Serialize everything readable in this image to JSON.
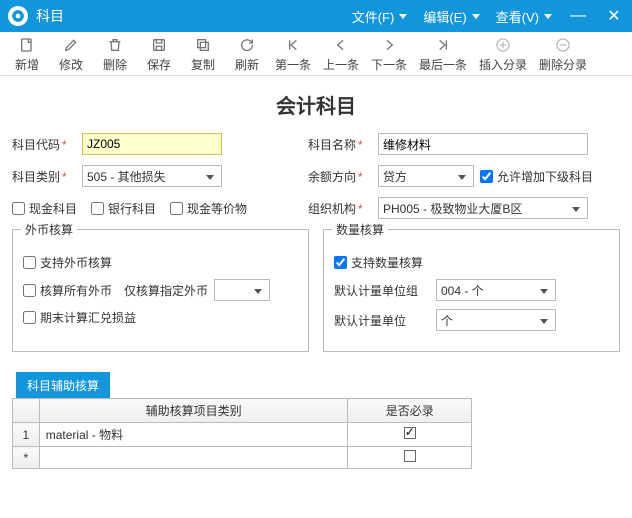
{
  "window": {
    "title": "科目",
    "menus": {
      "file": "文件(F)",
      "edit": "编辑(E)",
      "view": "查看(V)"
    }
  },
  "toolbar": {
    "new": "新增",
    "edit": "修改",
    "delete": "删除",
    "save": "保存",
    "copy": "复制",
    "refresh": "刷新",
    "first": "第一条",
    "prev": "上一条",
    "next": "下一条",
    "last": "最后一条",
    "insert_entry": "插入分录",
    "delete_entry": "删除分录"
  },
  "page_title": "会计科目",
  "fields": {
    "code_label": "科目代码",
    "code_value": "JZ005",
    "name_label": "科目名称",
    "name_value": "维修材料",
    "category_label": "科目类别",
    "category_value": "505 - 其他损失",
    "balance_dir_label": "余额方向",
    "balance_dir_value": "贷方",
    "allow_child_label": "允许增加下级科目",
    "allow_child_checked": true,
    "cash_label": "现金科目",
    "bank_label": "银行科目",
    "cash_equiv_label": "现金等价物",
    "org_label": "组织机构",
    "org_value": "PH005 - 极致物业大厦B区"
  },
  "forex_group": {
    "legend": "外币核算",
    "support_forex": "支持外币核算",
    "all_forex": "核算所有外币",
    "only_specified_label": "仅核算指定外币",
    "only_specified_value": "",
    "period_end_calc": "期末计算汇兑损益"
  },
  "qty_group": {
    "legend": "数量核算",
    "support_qty": "支持数量核算",
    "support_qty_checked": true,
    "default_group_label": "默认计量单位组",
    "default_group_value": "004 - 个",
    "default_unit_label": "默认计量单位",
    "default_unit_value": "个"
  },
  "aux": {
    "tab_label": "科目辅助核算",
    "columns": {
      "category": "辅助核算项目类别",
      "required": "是否必录"
    },
    "rows": [
      {
        "idx": "1",
        "category": "material  - 物料",
        "required": true
      }
    ],
    "new_row_marker": "*"
  }
}
